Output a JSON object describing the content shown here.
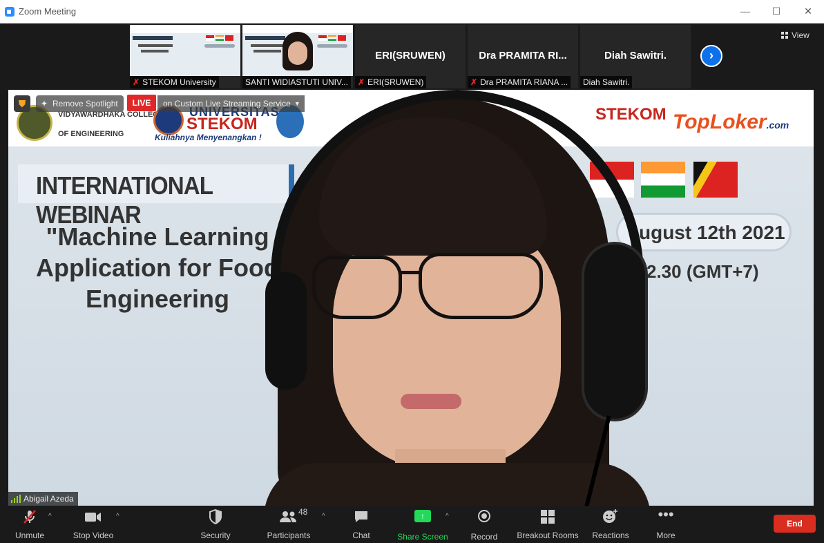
{
  "window": {
    "title": "Zoom Meeting",
    "minimize": "—",
    "maximize": "☐",
    "close": "✕"
  },
  "thumbnails": [
    {
      "name": "STEKOM University",
      "muted": true,
      "type": "slide"
    },
    {
      "name": "SANTI WIDIASTUTI UNIV...",
      "muted": false,
      "type": "slide-person"
    },
    {
      "name": "ERI(SRUWEN)",
      "big_name": "ERI(SRUWEN)",
      "muted": true,
      "type": "name"
    },
    {
      "name": "Dra PRAMITA RIANA ...",
      "big_name": "Dra PRAMITA RI...",
      "muted": true,
      "type": "name"
    },
    {
      "name": "Diah Sawitri.",
      "big_name": "Diah Sawitri.",
      "muted": false,
      "type": "name"
    }
  ],
  "view_button": "View",
  "main": {
    "remove_spotlight": "Remove Spotlight",
    "live_badge": "LIVE",
    "live_service": "on Custom Live Streaming Service",
    "speaker_name": "Abigail Azeda",
    "slide": {
      "college_line1": "VIDYAWARDHAKA COLLEGE",
      "college_line2": "OF ENGINEERING",
      "univ": "UNIVERSITAS",
      "stekom": "STEKOM",
      "tagline": "Kuliahnya Menyenangkan !",
      "stekom2": "STEKOM",
      "toploker": "TopLoker",
      "toploker_suffix": ".com",
      "banner": "INTERNATIONAL WEBINAR",
      "topic": "\"Machine Learning Application for Food Engineering",
      "date": "ugust 12th 2021",
      "time": "2.30 (GMT+7)"
    }
  },
  "toolbar": {
    "unmute": "Unmute",
    "stop_video": "Stop Video",
    "security": "Security",
    "participants": "Participants",
    "participants_count": "48",
    "chat": "Chat",
    "share_screen": "Share Screen",
    "record": "Record",
    "breakout_rooms": "Breakout Rooms",
    "reactions": "Reactions",
    "more": "More",
    "end": "End"
  },
  "colors": {
    "accent": "#2d8cff",
    "live_red": "#e02828",
    "end_red": "#d92d20",
    "share_green": "#23d959"
  }
}
